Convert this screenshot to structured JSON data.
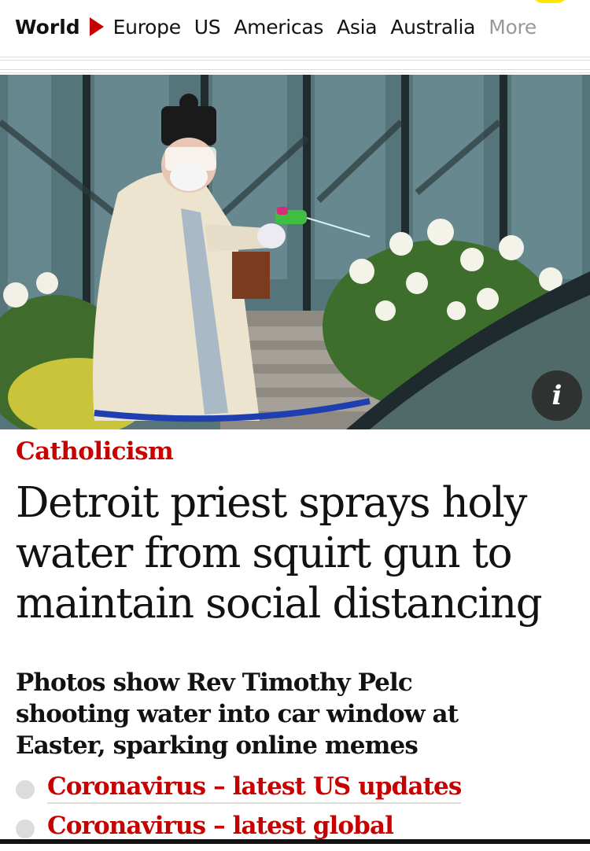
{
  "nav": {
    "pillar": "World",
    "items": [
      "Europe",
      "US",
      "Americas",
      "Asia",
      "Australia"
    ],
    "more": "More"
  },
  "hero": {
    "alt_subject": "priest-with-squirt-gun-photo",
    "info_label": "i"
  },
  "article": {
    "kicker": "Catholicism",
    "headline": "Detroit priest sprays holy water from squirt gun to maintain social distancing",
    "standfirst": "Photos show Rev Timothy Pelc shooting water into car window at Easter, sparking online memes",
    "links": [
      "Coronavirus – latest US updates",
      "Coronavirus – latest global"
    ]
  },
  "colors": {
    "accent": "#c70000",
    "text": "#121212",
    "muted": "#999999",
    "highlight": "#ffe500"
  }
}
